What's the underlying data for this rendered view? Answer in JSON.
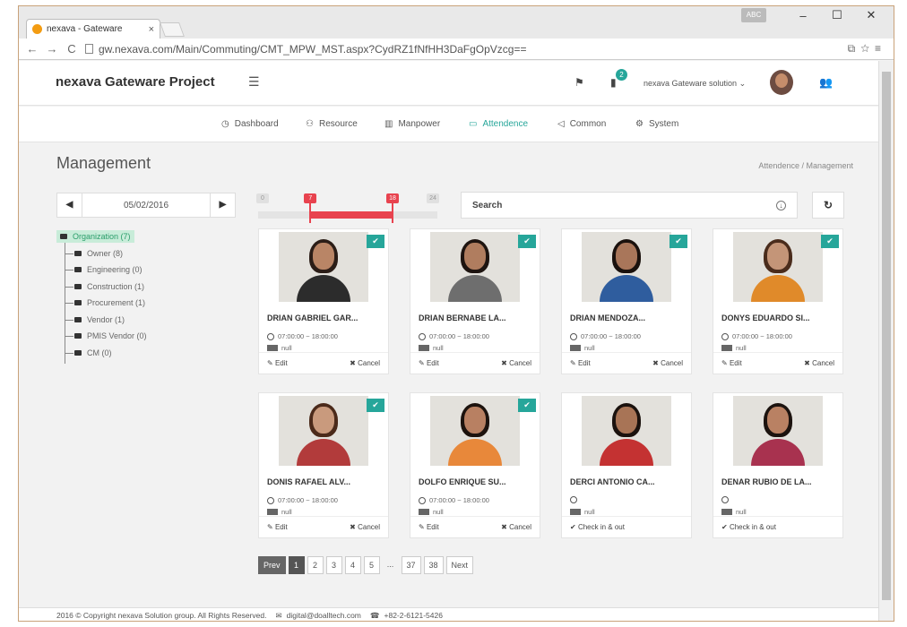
{
  "browser": {
    "tab_title": "nexava - Gateware",
    "tab_close": "×",
    "url": "gw.nexava.com/Main/Commuting/CMT_MPW_MST.aspx?CydRZ1fNfHH3DaFgOpVzcg==",
    "window_controls": {
      "minimize": "–",
      "maximize": "☐",
      "close": "✕"
    },
    "badge": "ABC"
  },
  "header": {
    "brand": "nexava Gateware Project",
    "notification_count": "2",
    "user_label": "nexava Gateware solution ⌄"
  },
  "menu": [
    {
      "label": "Dashboard",
      "icon": "◷",
      "active": false
    },
    {
      "label": "Resource",
      "icon": "⚇",
      "active": false
    },
    {
      "label": "Manpower",
      "icon": "▥",
      "active": false
    },
    {
      "label": "Attendence",
      "icon": "▭",
      "active": true
    },
    {
      "label": "Common",
      "icon": "◁",
      "active": false
    },
    {
      "label": "System",
      "icon": "⚙",
      "active": false
    }
  ],
  "page": {
    "title": "Management",
    "breadcrumb": "Attendence  /  Management"
  },
  "date": {
    "value": "05/02/2016",
    "prev": "◀",
    "next": "▶"
  },
  "tree": {
    "root": "Organization (7)",
    "children": [
      "Owner (8)",
      "Engineering (0)",
      "Construction (1)",
      "Procurement (1)",
      "Vendor (1)",
      "PMIS Vendor (0)",
      "CM (0)"
    ]
  },
  "slider": {
    "min": "0",
    "low": "7",
    "high": "18",
    "max": "24",
    "low_value": 7,
    "high_value": 18,
    "max_value": 24
  },
  "search": {
    "placeholder": "Search"
  },
  "cards": [
    {
      "name": "DRIAN GABRIEL GAR...",
      "time": "07:00:00 ~ 18:00:00",
      "info": "null",
      "checked": true,
      "action1": "Edit",
      "action2": "Cancel",
      "skin": "#b98566",
      "hair": "#2b1d17",
      "shirt": "#2c2c2c"
    },
    {
      "name": "DRIAN BERNABE LA...",
      "time": "07:00:00 ~ 18:00:00",
      "info": "null",
      "checked": true,
      "action1": "Edit",
      "action2": "Cancel",
      "skin": "#b07d5f",
      "hair": "#1e1410",
      "shirt": "#6e6e6e"
    },
    {
      "name": "DRIAN MENDOZA...",
      "time": "07:00:00 ~ 18:00:00",
      "info": "null",
      "checked": true,
      "action1": "Edit",
      "action2": "Cancel",
      "skin": "#a9765a",
      "hair": "#1a110d",
      "shirt": "#2f5d9e"
    },
    {
      "name": "DONYS EDUARDO SI...",
      "time": "07:00:00 ~ 18:00:00",
      "info": "null",
      "checked": true,
      "action1": "Edit",
      "action2": "Cancel",
      "skin": "#c49578",
      "hair": "#4a2c1c",
      "shirt": "#e08a2a"
    },
    {
      "name": "DONIS RAFAEL ALV...",
      "time": "07:00:00 ~ 18:00:00",
      "info": "null",
      "checked": true,
      "action1": "Edit",
      "action2": "Cancel",
      "skin": "#c99a7d",
      "hair": "#4b2a1a",
      "shirt": "#b23b3b"
    },
    {
      "name": "DOLFO ENRIQUE SU...",
      "time": "07:00:00 ~ 18:00:00",
      "info": "null",
      "checked": true,
      "action1": "Edit",
      "action2": "Cancel",
      "skin": "#b88062",
      "hair": "#1d130e",
      "shirt": "#e8883a"
    },
    {
      "name": "DERCI ANTONIO CA...",
      "time": "",
      "info": "null",
      "checked": false,
      "action1": "Check in & out",
      "action2": "",
      "skin": "#a87456",
      "hair": "#1b120e",
      "shirt": "#c43232"
    },
    {
      "name": "DENAR RUBIO DE LA...",
      "time": "",
      "info": "null",
      "checked": false,
      "action1": "Check in & out",
      "action2": "",
      "skin": "#b98163",
      "hair": "#1c130f",
      "shirt": "#a8324f"
    }
  ],
  "pager": {
    "prev": "Prev",
    "pages": [
      "1",
      "2",
      "3",
      "4",
      "5"
    ],
    "ellipsis": "...",
    "tail": [
      "37",
      "38"
    ],
    "next": "Next",
    "current": "1"
  },
  "footer": {
    "copyright": "2016 © Copyright nexava Solution group. All Rights Reserved.",
    "email": "digital@doalltech.com",
    "phone": "+82-2-6121-5426"
  }
}
